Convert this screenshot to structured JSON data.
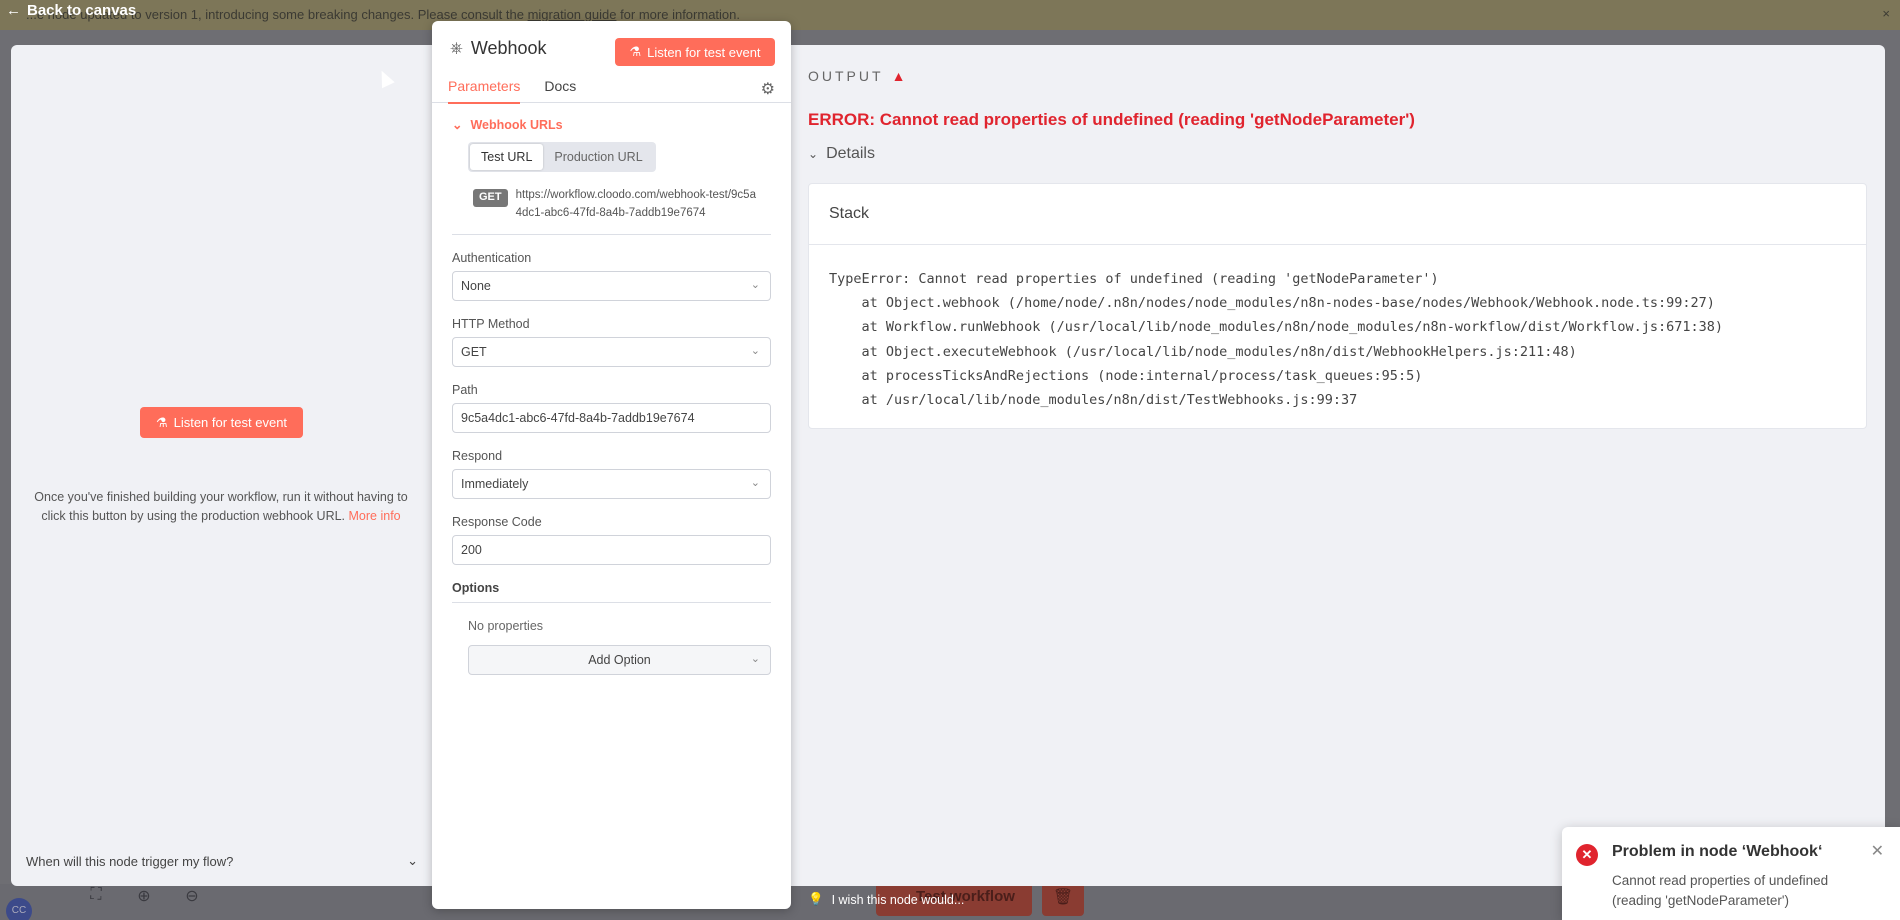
{
  "background": {
    "banner_prefix": "...e node updated to version 1, introducing some breaking changes. Please consult the ",
    "banner_link": "migration guide",
    "banner_suffix": " for more information.",
    "banner_close": "×",
    "test_workflow_label": "Test workflow",
    "avatar_initials": "CC"
  },
  "nav": {
    "back_label": "Back to canvas"
  },
  "left": {
    "listen_label": "Listen for test event",
    "help_text": "Once you've finished building your workflow, run it without having to click this button by using the production webhook URL.",
    "more_info": "More info",
    "trigger_question": "When will this node trigger my flow?"
  },
  "node": {
    "title": "Webhook",
    "listen_label": "Listen for test event",
    "tabs": [
      "Parameters",
      "Docs"
    ],
    "webhook_urls_label": "Webhook URLs",
    "url_tabs": [
      "Test URL",
      "Production URL"
    ],
    "method_badge": "GET",
    "test_url": "https://workflow.cloodo.com/webhook-test/9c5a4dc1-abc6-47fd-8a4b-7addb19e7674",
    "fields": {
      "authentication": {
        "label": "Authentication",
        "value": "None"
      },
      "http_method": {
        "label": "HTTP Method",
        "value": "GET"
      },
      "path": {
        "label": "Path",
        "value": "9c5a4dc1-abc6-47fd-8a4b-7addb19e7674"
      },
      "respond": {
        "label": "Respond",
        "value": "Immediately"
      },
      "response_code": {
        "label": "Response Code",
        "value": "200"
      }
    },
    "options_label": "Options",
    "no_properties": "No properties",
    "add_option": "Add Option"
  },
  "output": {
    "title": "OUTPUT",
    "error": "ERROR: Cannot read properties of undefined (reading 'getNodeParameter')",
    "details_label": "Details",
    "stack_label": "Stack",
    "stack_lines": [
      "TypeError: Cannot read properties of undefined (reading 'getNodeParameter')",
      "    at Object.webhook (/home/node/.n8n/nodes/node_modules/n8n-nodes-base/nodes/Webhook/Webhook.node.ts:99:27)",
      "    at Workflow.runWebhook (/usr/local/lib/node_modules/n8n/node_modules/n8n-workflow/dist/Workflow.js:671:38)",
      "    at Object.executeWebhook (/usr/local/lib/node_modules/n8n/dist/WebhookHelpers.js:211:48)",
      "    at processTicksAndRejections (node:internal/process/task_queues:95:5)",
      "    at /usr/local/lib/node_modules/n8n/dist/TestWebhooks.js:99:37"
    ],
    "wish_label": "I wish this node would..."
  },
  "toast": {
    "title": "Problem in node ‘Webhook‘",
    "body": "Cannot read properties of undefined (reading 'getNodeParameter')"
  },
  "colors": {
    "accent": "#ff6d5a",
    "error": "#e0242e",
    "panel_bg": "#f0f1f5"
  }
}
